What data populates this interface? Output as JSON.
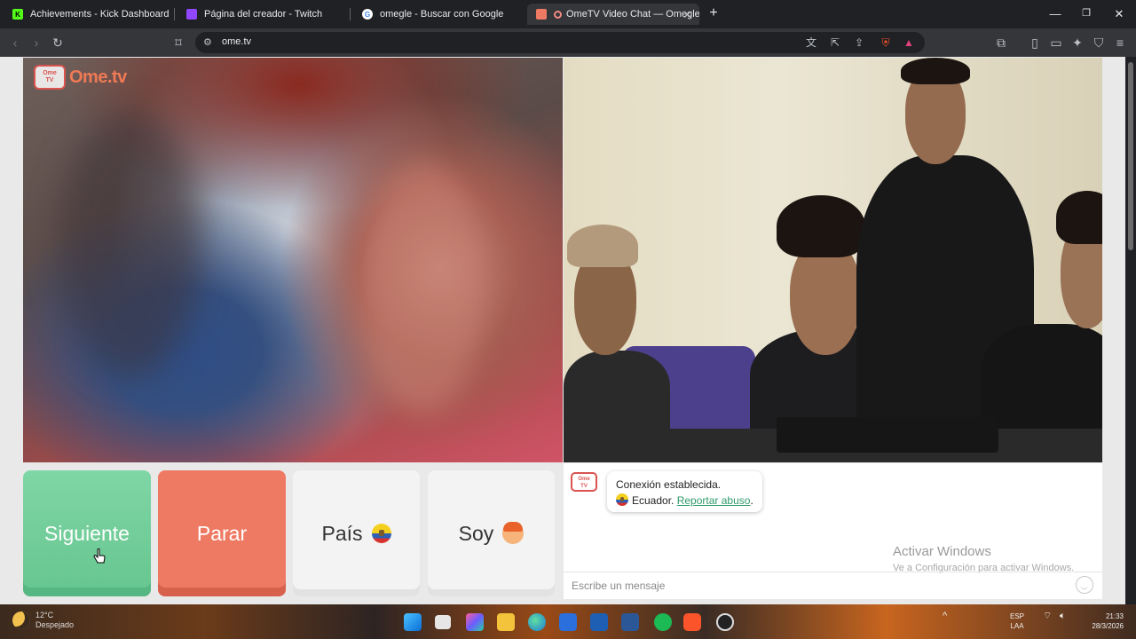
{
  "tabs": [
    {
      "title": "Achievements - Kick Dashboard",
      "favicon": "kick-icon",
      "color": "#53fc18"
    },
    {
      "title": "Página del creador - Twitch",
      "favicon": "twitch-icon",
      "color": "#9146ff"
    },
    {
      "title": "omegle - Buscar con Google",
      "favicon": "google-icon",
      "color": "#ffffff"
    },
    {
      "title": "OmeTV Video Chat — Omegle",
      "favicon": "ometv-icon",
      "color": "#ee7a63",
      "active": true
    }
  ],
  "address_bar": {
    "url": "ome.tv"
  },
  "logo": {
    "badge": "Ome TV",
    "text": "Ome.tv"
  },
  "buttons": {
    "next": "Siguiente",
    "stop": "Parar",
    "country": "País",
    "gender": "Soy"
  },
  "chat": {
    "status": "Conexión establecida.",
    "country": "Ecuador.",
    "report": "Reportar abuso",
    "report_suffix": ".",
    "placeholder": "Escribe un mensaje"
  },
  "watermark": {
    "title": "Activar Windows",
    "subtitle": "Ve a Configuración para activar Windows."
  },
  "taskbar": {
    "weather_temp": "12°C",
    "weather_desc": "Despejado",
    "lang": "ESP",
    "lang2": "LAA",
    "time": "21:33",
    "date": "28/3/2026"
  },
  "colors": {
    "next": "#6fcf97",
    "stop": "#ee7a63",
    "accent_link": "#2e9a6a"
  }
}
